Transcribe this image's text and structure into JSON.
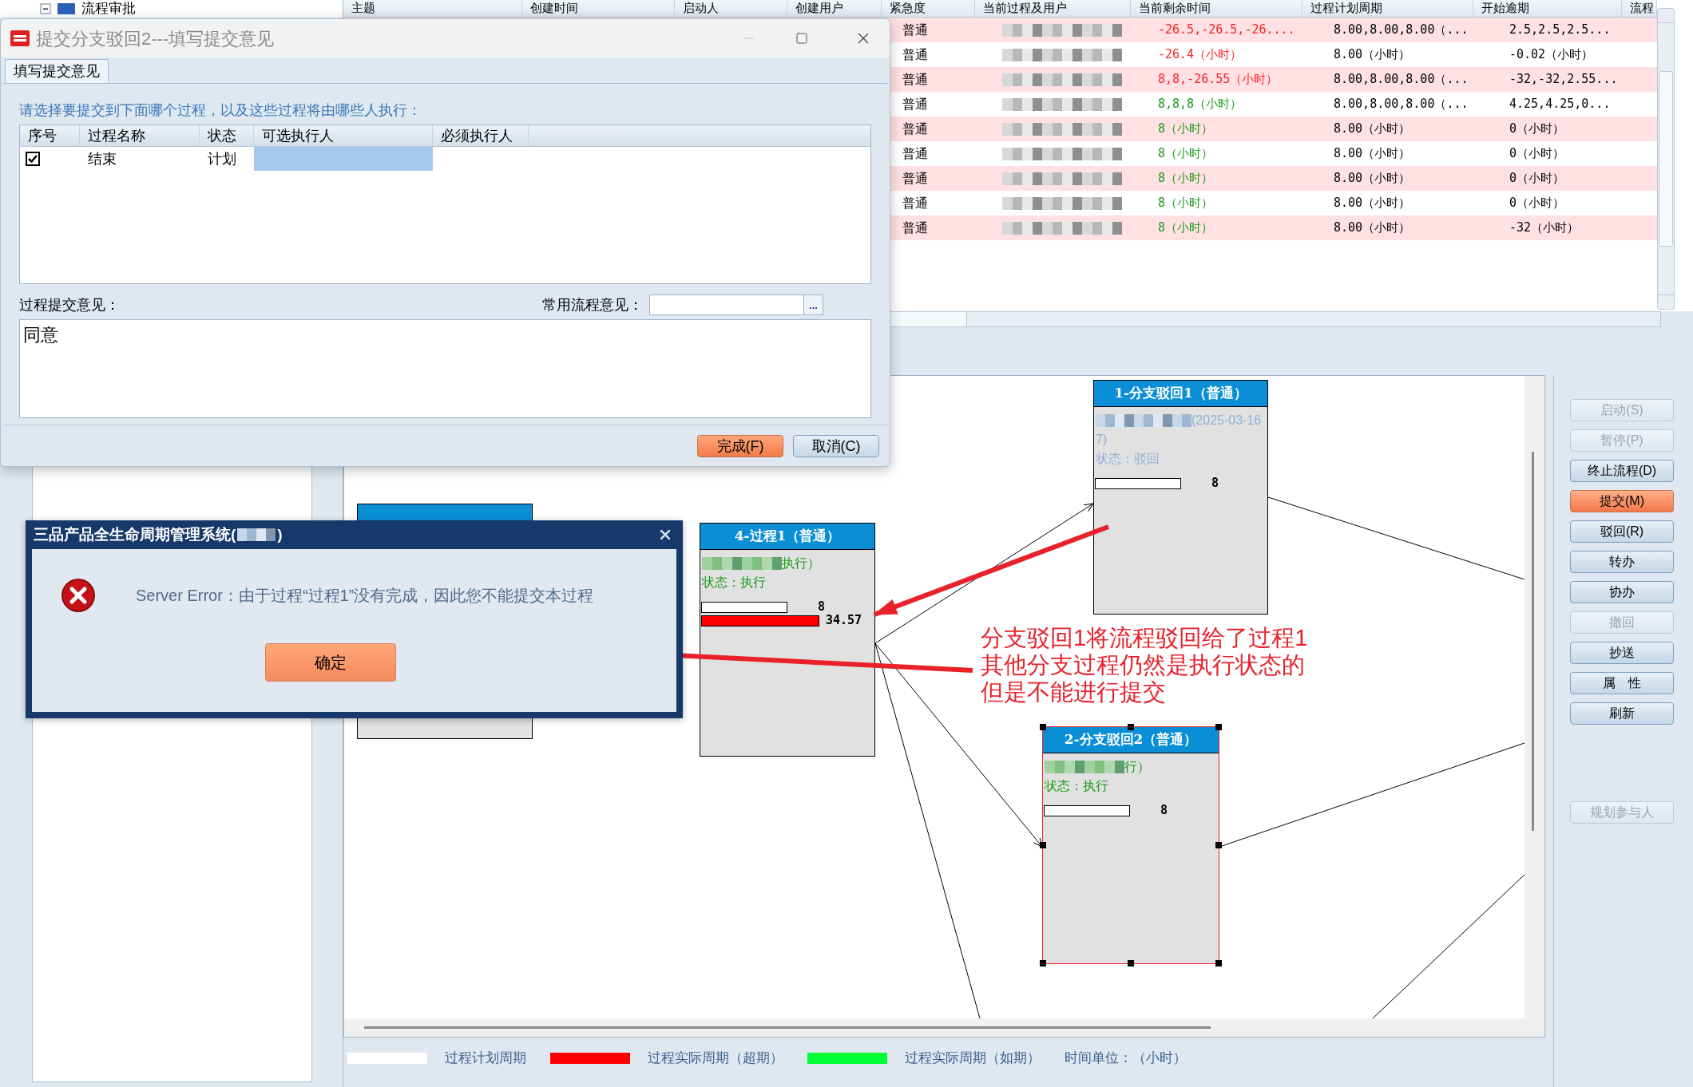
{
  "tree": {
    "label": "流程审批"
  },
  "table": {
    "columns": [
      "主题",
      "创建时间",
      "启动人",
      "创建用户",
      "紧急度",
      "当前过程及用户",
      "当前剩余时间",
      "过程计划周期",
      "开始逾期",
      "流程"
    ],
    "rows": [
      {
        "urgency": "普通",
        "remaining": "-26.5,-26.5,-26....",
        "overdue": true,
        "plan": "8.00,8.00,8.00（...",
        "delay": "2.5,2.5,2.5..."
      },
      {
        "urgency": "普通",
        "remaining": "-26.4（小时）",
        "overdue": true,
        "plan": "8.00（小时）",
        "delay": "-0.02（小时）"
      },
      {
        "urgency": "普通",
        "remaining": "8,8,-26.55（小时）",
        "overdue": true,
        "plan": "8.00,8.00,8.00（...",
        "delay": "-32,-32,2.55..."
      },
      {
        "urgency": "普通",
        "remaining": "8,8,8（小时）",
        "overdue": false,
        "plan": "8.00,8.00,8.00（...",
        "delay": "4.25,4.25,0..."
      },
      {
        "urgency": "普通",
        "remaining": "8（小时）",
        "overdue": false,
        "plan": "8.00（小时）",
        "delay": "0（小时）"
      },
      {
        "urgency": "普通",
        "remaining": "8（小时）",
        "overdue": false,
        "plan": "8.00（小时）",
        "delay": "0（小时）"
      },
      {
        "urgency": "普通",
        "remaining": "8（小时）",
        "overdue": false,
        "plan": "8.00（小时）",
        "delay": "0（小时）"
      },
      {
        "urgency": "普通",
        "remaining": "8（小时）",
        "overdue": false,
        "plan": "8.00（小时）",
        "delay": "0（小时）"
      },
      {
        "urgency": "普通",
        "remaining": "8（小时）",
        "overdue": false,
        "plan": "8.00（小时）",
        "delay": "-32（小时）"
      }
    ]
  },
  "diagram": {
    "nodes": [
      {
        "title": "4-过程1（普通）",
        "rejected": false,
        "selected": false,
        "lines": [
          "执行）",
          "状态：执行"
        ],
        "bars": [
          {
            "kind": "plan",
            "value": "8"
          },
          {
            "kind": "overdue",
            "value": "34.57"
          }
        ]
      },
      {
        "title": "1-分支驳回1（普通）",
        "rejected": true,
        "selected": false,
        "lines": [
          "(2025-03-16",
          "7)",
          "状态：驳回"
        ],
        "bars": [
          {
            "kind": "plan",
            "value": "8"
          }
        ]
      },
      {
        "title": "2-分支驳回2（普通）",
        "rejected": false,
        "selected": true,
        "lines": [
          "行）",
          "状态：执行"
        ],
        "bars": [
          {
            "kind": "plan",
            "value": "8"
          }
        ]
      }
    ],
    "legend": [
      {
        "label": "过程计划周期",
        "color": "#ffffff"
      },
      {
        "label": "过程实际周期（超期）",
        "color": "#ff0000"
      },
      {
        "label": "过程实际周期（如期）",
        "color": "#00ff33"
      }
    ],
    "unit": "时间单位：（小时）"
  },
  "buttons": [
    {
      "label": "启动(S)",
      "disabled": true,
      "highlighted": false
    },
    {
      "label": "暂停(P)",
      "disabled": true,
      "highlighted": false
    },
    {
      "label": "终止流程(D)",
      "disabled": false,
      "highlighted": false
    },
    {
      "label": "提交(M)",
      "disabled": false,
      "highlighted": true
    },
    {
      "label": "驳回(R)",
      "disabled": false,
      "highlighted": false
    },
    {
      "label": "转办",
      "disabled": false,
      "highlighted": false
    },
    {
      "label": "协办",
      "disabled": false,
      "highlighted": false
    },
    {
      "label": "撤回",
      "disabled": true,
      "highlighted": false
    },
    {
      "label": "抄送",
      "disabled": false,
      "highlighted": false
    },
    {
      "label": "属　性",
      "disabled": false,
      "highlighted": false
    },
    {
      "label": "刷新",
      "disabled": false,
      "highlighted": false
    }
  ],
  "bottom_buttons": [
    {
      "label": "规划参与人",
      "disabled": true,
      "highlighted": false
    }
  ],
  "annotation": {
    "lines": [
      "分支驳回1将流程驳回给了过程1",
      "其他分支过程仍然是执行状态的",
      "但是不能进行提交"
    ]
  },
  "submit_dialog": {
    "title": "提交分支驳回2---填写提交意见",
    "tab": "填写提交意见",
    "instruction": "请选择要提交到下面哪个过程，以及这些过程将由哪些人执行：",
    "columns": [
      "序号",
      "过程名称",
      "状态",
      "可选执行人",
      "必须执行人"
    ],
    "rows": [
      {
        "checked": true,
        "name": "结束",
        "status": "计划",
        "selected": true
      }
    ],
    "opinion_label": "过程提交意见：",
    "common_label": "常用流程意见：",
    "browse": "...",
    "opinion": "同意",
    "buttons": [
      {
        "label": "完成(F)",
        "highlighted": true
      },
      {
        "label": "取消(C)",
        "highlighted": false
      }
    ]
  },
  "error_dialog": {
    "title": "三品产品全生命周期管理系统(",
    "title_end": ")",
    "message": "Server Error：由于过程“过程1”没有完成，因此您不能提交本过程",
    "ok": "确定"
  }
}
